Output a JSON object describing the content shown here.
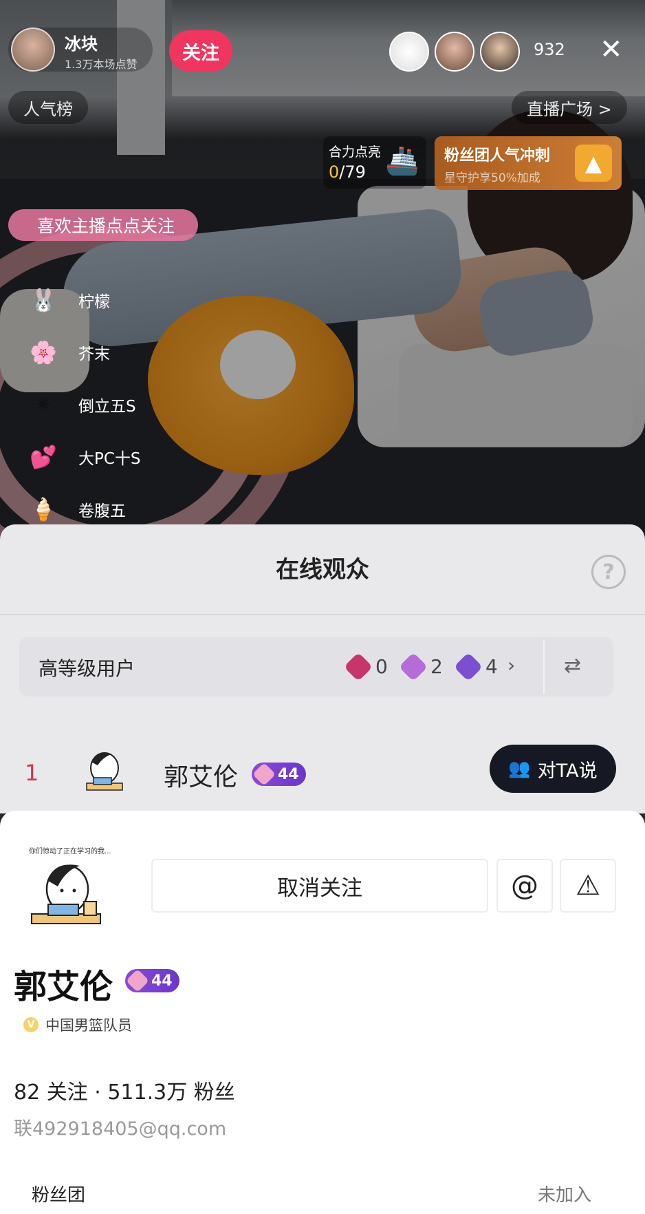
{
  "live": {
    "host_name": "冰块",
    "host_likes": "1.3万本场点赞",
    "follow_label": "关注",
    "viewer_count": "932",
    "close_icon": "close-icon",
    "popularity_label": "人气榜",
    "plaza_label": "直播广场 >",
    "task": {
      "title": "合力点亮",
      "current": "0",
      "total": "/79"
    },
    "fan_boost": {
      "title": "粉丝团人气冲刺",
      "subtitle": "星守护享50%加成"
    },
    "like_prompt": "喜欢主播点点关注",
    "gifts": [
      {
        "label": "柠檬",
        "icon": "bunny-icon"
      },
      {
        "label": "芥末",
        "icon": "flower-icon"
      },
      {
        "label": "倒立五S",
        "icon": "star-icon"
      },
      {
        "label": "大PC十S",
        "icon": "hearts-icon"
      },
      {
        "label": "卷腹五",
        "icon": "cone-icon"
      }
    ]
  },
  "audience": {
    "title": "在线观众",
    "high_level": {
      "label": "高等级用户",
      "stats": [
        {
          "value": "0",
          "color": "#c7366b"
        },
        {
          "value": "2",
          "color": "#b56bd8"
        },
        {
          "value": "4",
          "color": "#7b4fd0"
        }
      ]
    },
    "top_user": {
      "rank": "1",
      "name": "郭艾伦",
      "level": "44",
      "say_label": "对TA说"
    }
  },
  "profile": {
    "avatar_caption": "你们惊动了正在学习的我...",
    "unfollow_label": "取消关注",
    "mention_symbol": "@",
    "report_symbol": "⚠",
    "name": "郭艾伦",
    "level": "44",
    "verified_mark": "V",
    "verified_title": "中国男篮队员",
    "stats": "82 关注 · 511.3万 粉丝",
    "contact": "联492918405@qq.com",
    "fan_club_label": "粉丝团",
    "fan_club_value": "未加入"
  }
}
